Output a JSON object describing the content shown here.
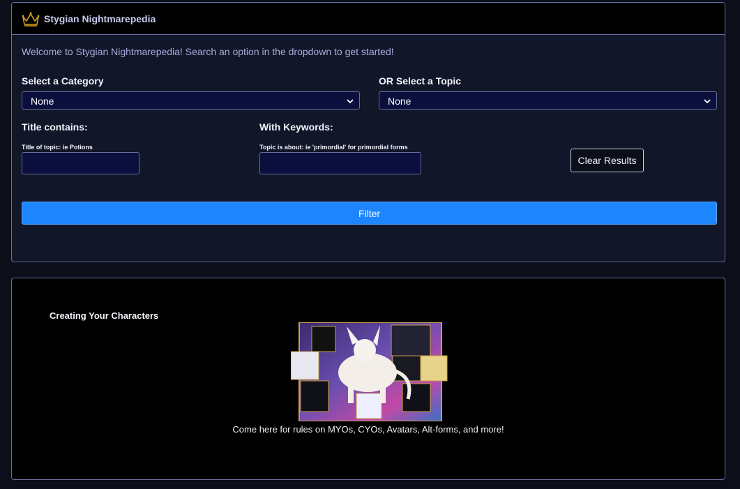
{
  "app": {
    "title": "Stygian Nightmarepedia",
    "logo_icon": "crown-icon",
    "welcome": "Welcome to Stygian Nightmarepedia! Search an option in the dropdown to get started!"
  },
  "filters": {
    "category": {
      "label": "Select a Category",
      "value": "None"
    },
    "topic": {
      "label": "OR Select a Topic",
      "value": "None"
    },
    "title_contains": {
      "label": "Title contains:",
      "hint": "Title of topic: ie Potions",
      "value": ""
    },
    "keywords": {
      "label": "With Keywords:",
      "hint": "Topic is about: ie 'primordial' for primordial forms",
      "value": ""
    },
    "clear_label": "Clear Results",
    "filter_label": "Filter"
  },
  "result": {
    "title": "Creating Your Characters",
    "caption": "Come here for rules on MYOs, CYOs, Avatars, Alt-forms, and more!"
  },
  "colors": {
    "background": "#0c0e1a",
    "panel": "#121629",
    "field": "#0a0f3d",
    "border": "#6c6f9c",
    "accent": "#1d86ff",
    "gold": "#d9a520"
  }
}
